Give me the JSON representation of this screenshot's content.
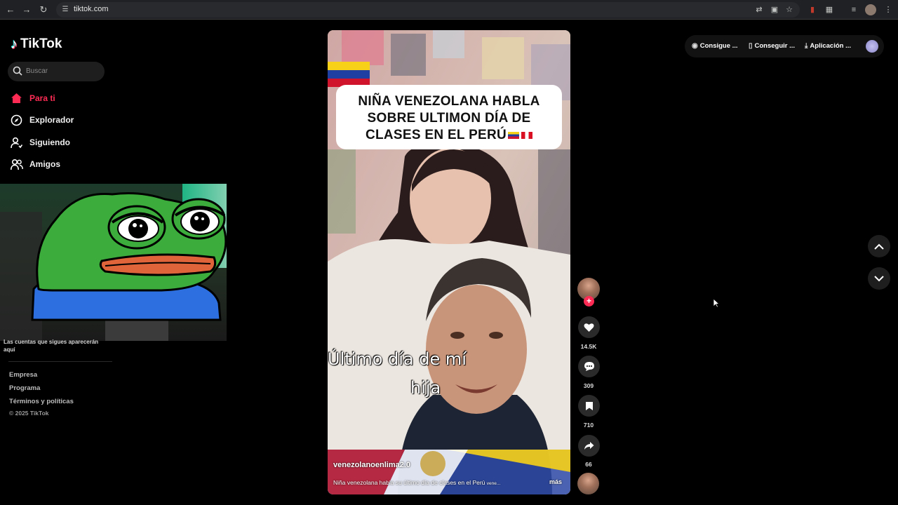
{
  "browser": {
    "url": "tiktok.com"
  },
  "sidebar": {
    "logo": "TikTok",
    "search_placeholder": "Buscar",
    "nav": [
      {
        "label": "Para ti",
        "icon": "home-icon",
        "active": true
      },
      {
        "label": "Explorador",
        "icon": "compass-icon",
        "active": false
      },
      {
        "label": "Siguiendo",
        "icon": "following-icon",
        "active": false
      },
      {
        "label": "Amigos",
        "icon": "friends-icon",
        "active": false
      }
    ],
    "following_note": "Las cuentas que sigues aparecerán aquí",
    "footer": {
      "links": [
        "Empresa",
        "Programa",
        "Términos y políticas"
      ],
      "copyright": "© 2025 TikTok"
    }
  },
  "header": {
    "buttons": [
      {
        "label": "Consigue ...",
        "icon": "coin-icon"
      },
      {
        "label": "Conseguir ...",
        "icon": "phone-icon"
      },
      {
        "label": "Aplicación ...",
        "icon": "download-icon"
      }
    ]
  },
  "video": {
    "overlay_title": [
      "NIÑA VENEZOLANA HABLA",
      "SOBRE ULTIMON DÍA DE",
      "CLASES EN EL PERÚ"
    ],
    "subtitle_lines": [
      "Último día de mí",
      "hija"
    ],
    "username": "venezolanoenlima2.0",
    "description": "Niña venezolana habla su último día de clases en el Perú",
    "description_suffix": "vene...",
    "more_label": "más"
  },
  "actions": {
    "likes": "14.5K",
    "comments": "309",
    "saves": "710",
    "shares": "66"
  },
  "colors": {
    "accent": "#fe2c55",
    "background": "#000000"
  }
}
